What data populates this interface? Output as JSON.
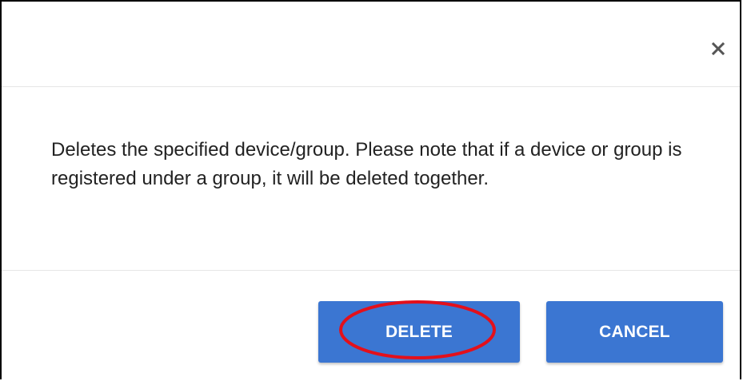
{
  "dialog": {
    "close_icon": "close-icon",
    "message": "Deletes the specified device/group. Please note that if a device or group is registered under a group, it will be deleted together.",
    "buttons": {
      "delete_label": "DELETE",
      "cancel_label": "CANCEL"
    }
  },
  "colors": {
    "button_background": "#3b76d2",
    "button_text": "#ffffff",
    "close_icon": "#555555",
    "annotation_ellipse": "#e3101b"
  }
}
